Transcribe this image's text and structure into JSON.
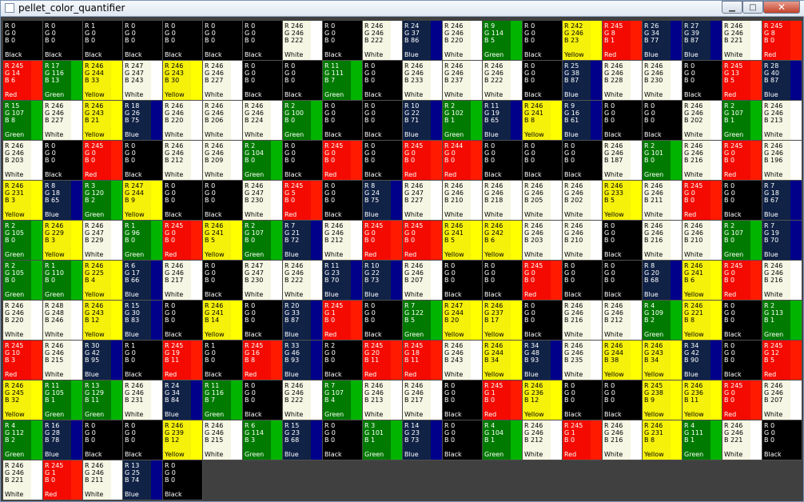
{
  "window": {
    "title": "pellet_color_quantifier"
  },
  "colors": {
    "White": {
      "bg": "#f6f6e4",
      "bar": "#ffffff",
      "fg": "#000000"
    },
    "Black": {
      "bg": "#000000",
      "bar": "#000000",
      "fg": "#ffffff"
    },
    "Red": {
      "bg": "#f40a00",
      "bar": "#ff1a00",
      "fg": "#ffffff"
    },
    "Yellow": {
      "bg": "#f6f10a",
      "bar": "#ffff00",
      "fg": "#000000"
    },
    "Green": {
      "bg": "#007a00",
      "bar": "#00b400",
      "fg": "#ffffff"
    },
    "Blue": {
      "bg": "#102245",
      "bar": "#00008a",
      "fg": "#ffffff"
    }
  },
  "rows": [
    [
      [
        0,
        0,
        0,
        "Black"
      ],
      [
        0,
        0,
        0,
        "Black"
      ],
      [
        1,
        0,
        0,
        "Black"
      ],
      [
        0,
        0,
        0,
        "Black"
      ],
      [
        0,
        0,
        0,
        "Black"
      ],
      [
        0,
        0,
        0,
        "Black"
      ],
      [
        0,
        0,
        0,
        "Black"
      ],
      [
        246,
        246,
        222,
        "White"
      ],
      [
        0,
        0,
        0,
        "Black"
      ],
      [
        246,
        246,
        222,
        "White"
      ],
      [
        24,
        37,
        86,
        "Blue"
      ],
      [
        246,
        246,
        220,
        "White"
      ],
      [
        9,
        114,
        5,
        "Green"
      ],
      [
        0,
        0,
        0,
        "Black"
      ],
      [
        242,
        246,
        23,
        "Yellow"
      ],
      [
        245,
        8,
        1,
        "Red"
      ],
      [
        26,
        34,
        77,
        "Blue"
      ],
      [
        27,
        39,
        87,
        "Blue"
      ],
      [
        246,
        246,
        221,
        "White"
      ],
      [
        245,
        8,
        0,
        "Red"
      ]
    ],
    [
      [
        245,
        14,
        6,
        "Red"
      ],
      [
        17,
        116,
        13,
        "Green"
      ],
      [
        246,
        244,
        33,
        "Yellow"
      ],
      [
        247,
        247,
        243,
        "White"
      ],
      [
        246,
        243,
        30,
        "Yellow"
      ],
      [
        246,
        246,
        227,
        "White"
      ],
      [
        0,
        0,
        0,
        "Black"
      ],
      [
        0,
        0,
        0,
        "Black"
      ],
      [
        11,
        111,
        7,
        "Green"
      ],
      [
        0,
        0,
        0,
        "Black"
      ],
      [
        246,
        246,
        233,
        "White"
      ],
      [
        246,
        246,
        237,
        "White"
      ],
      [
        246,
        246,
        222,
        "White"
      ],
      [
        0,
        0,
        0,
        "Black"
      ],
      [
        25,
        38,
        87,
        "Blue"
      ],
      [
        246,
        246,
        228,
        "White"
      ],
      [
        246,
        246,
        230,
        "White"
      ],
      [
        0,
        0,
        0,
        "Black"
      ],
      [
        245,
        13,
        5,
        "Red"
      ],
      [
        28,
        40,
        87,
        "Blue"
      ]
    ],
    [
      [
        15,
        107,
        8,
        "Green"
      ],
      [
        246,
        246,
        227,
        "White"
      ],
      [
        246,
        243,
        21,
        "Yellow"
      ],
      [
        18,
        26,
        75,
        "Blue"
      ],
      [
        246,
        246,
        220,
        "White"
      ],
      [
        246,
        246,
        206,
        "White"
      ],
      [
        246,
        246,
        224,
        "White"
      ],
      [
        2,
        100,
        0,
        "Green"
      ],
      [
        0,
        0,
        0,
        "Black"
      ],
      [
        0,
        0,
        0,
        "Black"
      ],
      [
        10,
        22,
        71,
        "Blue"
      ],
      [
        2,
        102,
        1,
        "Green"
      ],
      [
        11,
        19,
        65,
        "Blue"
      ],
      [
        246,
        241,
        8,
        "Yellow"
      ],
      [
        9,
        16,
        61,
        "Blue"
      ],
      [
        0,
        0,
        0,
        "Black"
      ],
      [
        0,
        0,
        0,
        "Black"
      ],
      [
        246,
        246,
        202,
        "White"
      ],
      [
        2,
        107,
        1,
        "Green"
      ],
      [
        246,
        246,
        213,
        "White"
      ]
    ],
    [
      [
        246,
        246,
        203,
        "White"
      ],
      [
        0,
        0,
        0,
        "Black"
      ],
      [
        245,
        0,
        0,
        "Red"
      ],
      [
        0,
        0,
        0,
        "Black"
      ],
      [
        246,
        246,
        212,
        "White"
      ],
      [
        246,
        246,
        209,
        "White"
      ],
      [
        2,
        104,
        0,
        "Green"
      ],
      [
        0,
        0,
        0,
        "Black"
      ],
      [
        245,
        0,
        0,
        "Red"
      ],
      [
        0,
        0,
        0,
        "Black"
      ],
      [
        245,
        0,
        0,
        "Red"
      ],
      [
        244,
        0,
        0,
        "Red"
      ],
      [
        0,
        0,
        0,
        "Black"
      ],
      [
        0,
        0,
        0,
        "Black"
      ],
      [
        0,
        0,
        0,
        "Black"
      ],
      [
        246,
        246,
        187,
        "White"
      ],
      [
        2,
        101,
        0,
        "Green"
      ],
      [
        246,
        246,
        216,
        "White"
      ],
      [
        245,
        0,
        0,
        "Red"
      ],
      [
        246,
        246,
        196,
        "White"
      ]
    ],
    [
      [
        246,
        231,
        3,
        "Yellow"
      ],
      [
        8,
        18,
        65,
        "Blue"
      ],
      [
        3,
        120,
        2,
        "Green"
      ],
      [
        247,
        244,
        9,
        "Yellow"
      ],
      [
        0,
        0,
        0,
        "Black"
      ],
      [
        0,
        0,
        0,
        "Black"
      ],
      [
        246,
        247,
        230,
        "White"
      ],
      [
        245,
        5,
        0,
        "Red"
      ],
      [
        0,
        0,
        0,
        "Black"
      ],
      [
        8,
        24,
        75,
        "Blue"
      ],
      [
        246,
        247,
        227,
        "White"
      ],
      [
        246,
        246,
        210,
        "White"
      ],
      [
        246,
        246,
        218,
        "White"
      ],
      [
        246,
        246,
        205,
        "White"
      ],
      [
        246,
        246,
        202,
        "White"
      ],
      [
        246,
        233,
        5,
        "Yellow"
      ],
      [
        246,
        246,
        211,
        "White"
      ],
      [
        245,
        0,
        0,
        "Red"
      ],
      [
        0,
        0,
        0,
        "Black"
      ],
      [
        7,
        18,
        67,
        "Blue"
      ]
    ],
    [
      [
        2,
        105,
        0,
        "Green"
      ],
      [
        246,
        229,
        3,
        "Yellow"
      ],
      [
        246,
        247,
        229,
        "White"
      ],
      [
        1,
        96,
        0,
        "Green"
      ],
      [
        245,
        0,
        0,
        "Red"
      ],
      [
        246,
        241,
        5,
        "Yellow"
      ],
      [
        2,
        107,
        0,
        "Green"
      ],
      [
        7,
        21,
        72,
        "Blue"
      ],
      [
        246,
        246,
        212,
        "White"
      ],
      [
        245,
        0,
        0,
        "Red"
      ],
      [
        245,
        0,
        0,
        "Red"
      ],
      [
        246,
        241,
        5,
        "Yellow"
      ],
      [
        246,
        242,
        6,
        "Yellow"
      ],
      [
        246,
        246,
        203,
        "White"
      ],
      [
        246,
        246,
        210,
        "White"
      ],
      [
        0,
        0,
        0,
        "Black"
      ],
      [
        246,
        246,
        216,
        "White"
      ],
      [
        246,
        246,
        210,
        "White"
      ],
      [
        2,
        107,
        0,
        "Green"
      ],
      [
        7,
        19,
        70,
        "Blue"
      ]
    ],
    [
      [
        2,
        105,
        0,
        "Green"
      ],
      [
        1,
        110,
        0,
        "Green"
      ],
      [
        246,
        225,
        4,
        "Yellow"
      ],
      [
        6,
        17,
        66,
        "Blue"
      ],
      [
        246,
        246,
        217,
        "White"
      ],
      [
        0,
        0,
        0,
        "Black"
      ],
      [
        247,
        247,
        230,
        "White"
      ],
      [
        246,
        246,
        222,
        "White"
      ],
      [
        11,
        23,
        70,
        "Blue"
      ],
      [
        10,
        22,
        73,
        "Blue"
      ],
      [
        246,
        246,
        207,
        "White"
      ],
      [
        0,
        0,
        0,
        "Black"
      ],
      [
        0,
        0,
        0,
        "Black"
      ],
      [
        245,
        0,
        0,
        "Red"
      ],
      [
        0,
        0,
        0,
        "Black"
      ],
      [
        0,
        0,
        0,
        "Black"
      ],
      [
        8,
        20,
        68,
        "Blue"
      ],
      [
        246,
        241,
        6,
        "Yellow"
      ],
      [
        245,
        0,
        0,
        "Red"
      ],
      [
        246,
        246,
        216,
        "White"
      ]
    ],
    [
      [
        246,
        246,
        220,
        "White"
      ],
      [
        248,
        248,
        246,
        "White"
      ],
      [
        246,
        243,
        12,
        "Yellow"
      ],
      [
        15,
        30,
        83,
        "Blue"
      ],
      [
        0,
        0,
        0,
        "Black"
      ],
      [
        246,
        241,
        14,
        "Yellow"
      ],
      [
        0,
        0,
        0,
        "Black"
      ],
      [
        20,
        33,
        87,
        "Blue"
      ],
      [
        245,
        1,
        0,
        "Red"
      ],
      [
        0,
        0,
        0,
        "Black"
      ],
      [
        7,
        122,
        5,
        "Green"
      ],
      [
        247,
        244,
        20,
        "Yellow"
      ],
      [
        246,
        237,
        17,
        "Yellow"
      ],
      [
        0,
        0,
        0,
        "Black"
      ],
      [
        246,
        246,
        216,
        "White"
      ],
      [
        246,
        246,
        212,
        "White"
      ],
      [
        4,
        109,
        2,
        "Green"
      ],
      [
        246,
        221,
        8,
        "Yellow"
      ],
      [
        0,
        0,
        0,
        "Black"
      ],
      [
        2,
        113,
        1,
        "Green"
      ]
    ],
    [
      [
        245,
        10,
        3,
        "Red"
      ],
      [
        246,
        246,
        215,
        "White"
      ],
      [
        30,
        42,
        95,
        "Blue"
      ],
      [
        1,
        0,
        0,
        "Black"
      ],
      [
        245,
        19,
        11,
        "Red"
      ],
      [
        1,
        0,
        0,
        "Black"
      ],
      [
        245,
        16,
        8,
        "Red"
      ],
      [
        33,
        46,
        93,
        "Blue"
      ],
      [
        2,
        0,
        0,
        "Black"
      ],
      [
        245,
        20,
        11,
        "Red"
      ],
      [
        245,
        18,
        11,
        "Red"
      ],
      [
        246,
        246,
        243,
        "White"
      ],
      [
        246,
        244,
        34,
        "Yellow"
      ],
      [
        34,
        48,
        93,
        "Blue"
      ],
      [
        246,
        246,
        235,
        "White"
      ],
      [
        246,
        244,
        38,
        "Yellow"
      ],
      [
        246,
        243,
        34,
        "Yellow"
      ],
      [
        34,
        42,
        90,
        "Blue"
      ],
      [
        0,
        0,
        0,
        "Black"
      ],
      [
        245,
        12,
        5,
        "Red"
      ]
    ],
    [
      [
        246,
        245,
        32,
        "Yellow"
      ],
      [
        11,
        105,
        1,
        "Green"
      ],
      [
        13,
        129,
        11,
        "Green"
      ],
      [
        246,
        246,
        231,
        "White"
      ],
      [
        24,
        34,
        84,
        "Blue"
      ],
      [
        11,
        116,
        7,
        "Green"
      ],
      [
        0,
        0,
        0,
        "Black"
      ],
      [
        246,
        246,
        222,
        "White"
      ],
      [
        7,
        107,
        4,
        "Green"
      ],
      [
        246,
        246,
        213,
        "White"
      ],
      [
        246,
        246,
        217,
        "White"
      ],
      [
        0,
        0,
        0,
        "Black"
      ],
      [
        245,
        1,
        0,
        "Red"
      ],
      [
        246,
        236,
        12,
        "Yellow"
      ],
      [
        0,
        0,
        0,
        "Black"
      ],
      [
        0,
        0,
        0,
        "Black"
      ],
      [
        245,
        238,
        9,
        "Yellow"
      ],
      [
        246,
        236,
        11,
        "Yellow"
      ],
      [
        245,
        0,
        0,
        "Red"
      ],
      [
        246,
        246,
        207,
        "White"
      ]
    ],
    [
      [
        4,
        112,
        2,
        "Green"
      ],
      [
        16,
        28,
        78,
        "Blue"
      ],
      [
        0,
        0,
        0,
        "Black"
      ],
      [
        0,
        0,
        0,
        "Black"
      ],
      [
        246,
        239,
        12,
        "Yellow"
      ],
      [
        246,
        246,
        215,
        "White"
      ],
      [
        6,
        114,
        3,
        "Green"
      ],
      [
        15,
        23,
        68,
        "Blue"
      ],
      [
        0,
        0,
        0,
        "Black"
      ],
      [
        3,
        101,
        1,
        "Green"
      ],
      [
        14,
        23,
        73,
        "Blue"
      ],
      [
        0,
        0,
        0,
        "Black"
      ],
      [
        4,
        104,
        1,
        "Green"
      ],
      [
        246,
        246,
        212,
        "White"
      ],
      [
        245,
        1,
        0,
        "Red"
      ],
      [
        246,
        246,
        216,
        "White"
      ],
      [
        246,
        231,
        8,
        "Yellow"
      ],
      [
        4,
        111,
        1,
        "Green"
      ],
      [
        246,
        246,
        221,
        "White"
      ],
      [
        0,
        0,
        0,
        "Black"
      ]
    ],
    [
      [
        246,
        246,
        221,
        "White"
      ],
      [
        245,
        1,
        0,
        "Red"
      ],
      [
        246,
        246,
        211,
        "White"
      ],
      [
        13,
        25,
        74,
        "Blue"
      ],
      [
        0,
        0,
        0,
        "Black"
      ]
    ]
  ]
}
